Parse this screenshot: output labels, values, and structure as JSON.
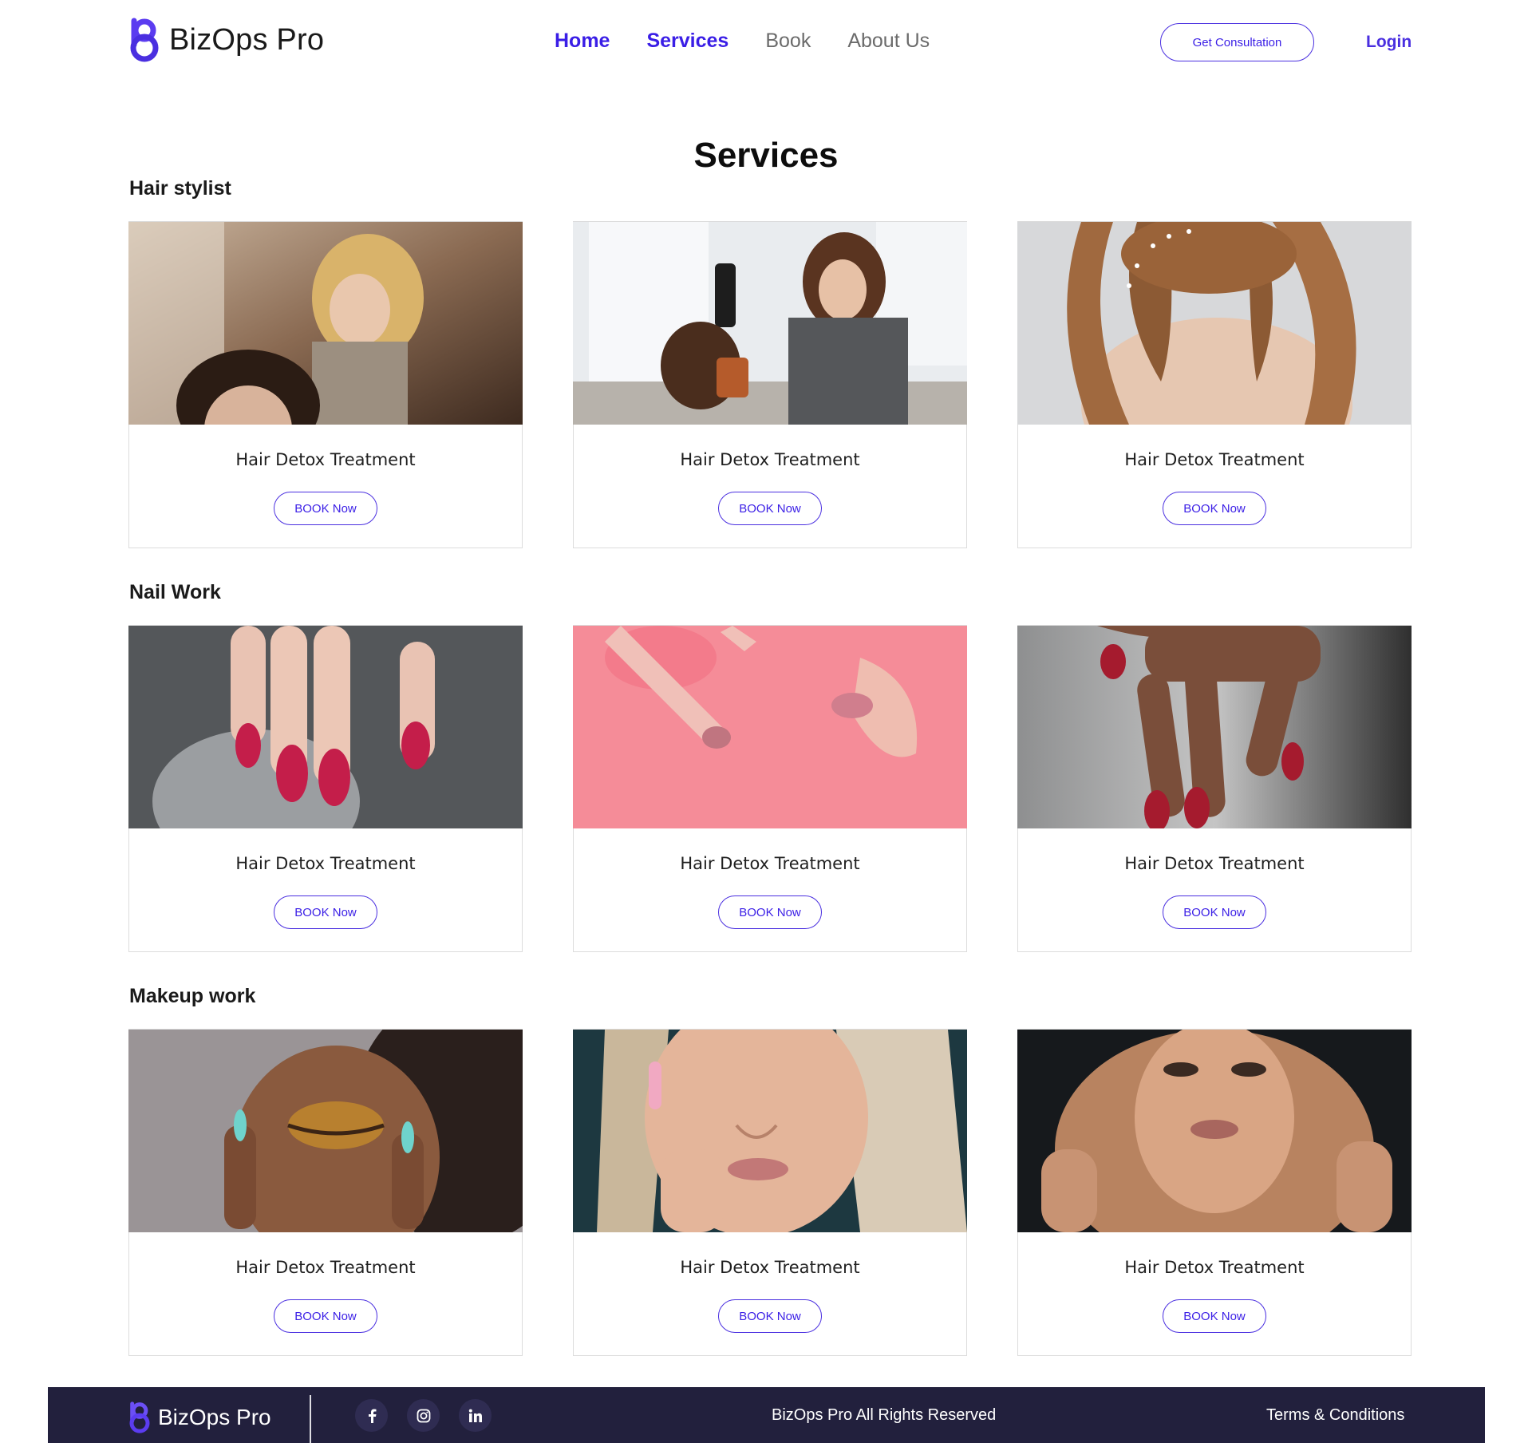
{
  "brand": {
    "name": "BizOps Pro",
    "accent": "#3a1ee6",
    "footer_bg": "#22203d"
  },
  "nav": {
    "items": [
      {
        "label": "Home",
        "state": "active"
      },
      {
        "label": "Services",
        "state": "active"
      },
      {
        "label": "Book",
        "state": "muted"
      },
      {
        "label": "About Us",
        "state": "muted"
      }
    ],
    "consultation_label": "Get Consultation",
    "login_label": "Login"
  },
  "page_title": "Services",
  "sections": [
    {
      "title": "Hair stylist",
      "cards": [
        {
          "title": "Hair Detox Treatment",
          "button": "BOOK Now",
          "image": "stylist-curling-hair-photo"
        },
        {
          "title": "Hair Detox Treatment",
          "button": "BOOK Now",
          "image": "stylist-blow-drying-photo"
        },
        {
          "title": "Hair Detox Treatment",
          "button": "BOOK Now",
          "image": "wavy-hair-accessory-photo"
        }
      ]
    },
    {
      "title": "Nail Work",
      "cards": [
        {
          "title": "Hair Detox Treatment",
          "button": "BOOK Now",
          "image": "red-love-nails-photo"
        },
        {
          "title": "Hair Detox Treatment",
          "button": "BOOK Now",
          "image": "pink-nails-photo"
        },
        {
          "title": "Hair Detox Treatment",
          "button": "BOOK Now",
          "image": "red-nails-hand-photo"
        }
      ]
    },
    {
      "title": "Makeup work",
      "cards": [
        {
          "title": "Hair Detox Treatment",
          "button": "BOOK Now",
          "image": "gold-eye-makeup-photo"
        },
        {
          "title": "Hair Detox Treatment",
          "button": "BOOK Now",
          "image": "blonde-makeup-photo"
        },
        {
          "title": "Hair Detox Treatment",
          "button": "BOOK Now",
          "image": "smokey-eye-makeup-photo"
        }
      ]
    }
  ],
  "footer": {
    "brand": "BizOps Pro",
    "socials": [
      "facebook-icon",
      "instagram-icon",
      "linkedin-icon"
    ],
    "rights": "BizOps Pro All Rights Reserved",
    "terms": "Terms & Conditions"
  }
}
